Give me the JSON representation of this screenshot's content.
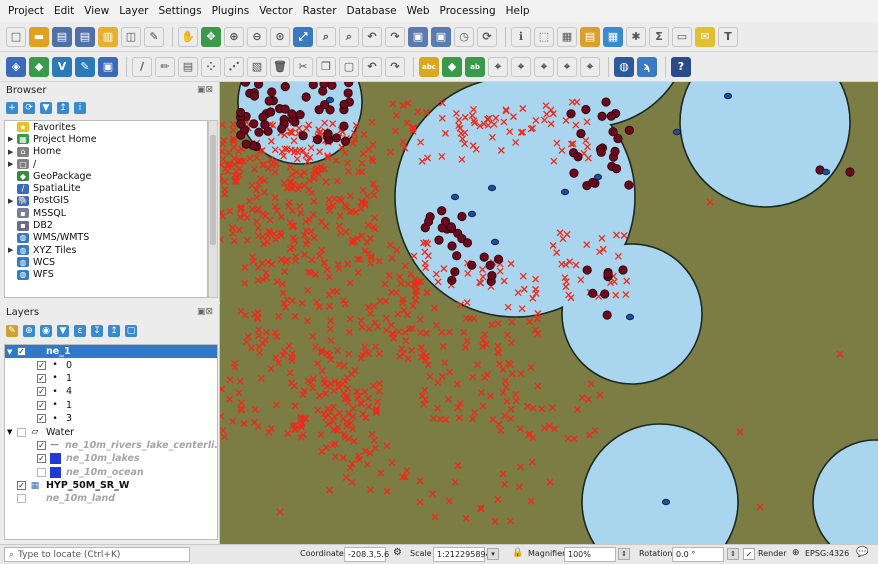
{
  "menubar": {
    "items": [
      "Project",
      "Edit",
      "View",
      "Layer",
      "Settings",
      "Plugins",
      "Vector",
      "Raster",
      "Database",
      "Web",
      "Processing",
      "Help"
    ]
  },
  "browser": {
    "title": "Browser",
    "items": [
      {
        "label": "Favorites",
        "icon": "star-icon",
        "arrow": ""
      },
      {
        "label": "Project Home",
        "icon": "project-home-icon",
        "arrow": "▶"
      },
      {
        "label": "Home",
        "icon": "home-folder-icon",
        "arrow": "▶"
      },
      {
        "label": "/",
        "icon": "root-folder-icon",
        "arrow": "▶"
      },
      {
        "label": "GeoPackage",
        "icon": "geopackage-icon",
        "arrow": ""
      },
      {
        "label": "SpatiaLite",
        "icon": "spatialite-icon",
        "arrow": ""
      },
      {
        "label": "PostGIS",
        "icon": "postgis-icon",
        "arrow": "▶"
      },
      {
        "label": "MSSQL",
        "icon": "mssql-icon",
        "arrow": ""
      },
      {
        "label": "DB2",
        "icon": "db2-icon",
        "arrow": ""
      },
      {
        "label": "WMS/WMTS",
        "icon": "wms-icon",
        "arrow": ""
      },
      {
        "label": "XYZ Tiles",
        "icon": "xyz-tiles-icon",
        "arrow": "▶"
      },
      {
        "label": "WCS",
        "icon": "wcs-icon",
        "arrow": ""
      },
      {
        "label": "WFS",
        "icon": "wfs-icon",
        "arrow": ""
      }
    ]
  },
  "layers": {
    "title": "Layers",
    "rows": [
      {
        "label": "ne_1",
        "indent": 0,
        "checked": true,
        "selected": true,
        "expand": "▼",
        "sym": "",
        "style": "bold"
      },
      {
        "label": "0",
        "indent": 1,
        "checked": true,
        "sym": "•",
        "style": ""
      },
      {
        "label": "1",
        "indent": 1,
        "checked": true,
        "sym": "•",
        "style": ""
      },
      {
        "label": "4",
        "indent": 1,
        "checked": true,
        "sym": "•",
        "style": ""
      },
      {
        "label": "1",
        "indent": 1,
        "checked": true,
        "sym": "•",
        "style": ""
      },
      {
        "label": "3",
        "indent": 1,
        "checked": true,
        "sym": "•",
        "style": ""
      },
      {
        "label": "Water",
        "indent": 0,
        "checked": false,
        "expand": "▼",
        "sym": "",
        "style": ""
      },
      {
        "label": "ne_10m_rivers_lake_centerli...",
        "indent": 1,
        "checked": true,
        "sym": "—",
        "style": "italic-grey"
      },
      {
        "label": "ne_10m_lakes",
        "indent": 1,
        "checked": true,
        "swatch": "#1f3ad6",
        "style": "italic-grey"
      },
      {
        "label": "ne_10m_ocean",
        "indent": 1,
        "checked": false,
        "swatch": "#1f3ad6",
        "style": "italic-grey"
      },
      {
        "label": "HYP_50M_SR_W",
        "indent": 0,
        "checked": true,
        "sym": "▦",
        "style": "bold"
      },
      {
        "label": "ne_10m_land",
        "indent": 0,
        "checked": false,
        "sym": "",
        "style": "italic-grey"
      }
    ]
  },
  "statusbar": {
    "locator_placeholder": "Type to locate (Ctrl+K)",
    "coordinate_label": "Coordinate",
    "coordinate_value": "-208.3,5.6",
    "scale_label": "Scale",
    "scale_value": "1:212295894",
    "magnifier_label": "Magnifier",
    "magnifier_value": "100%",
    "rotation_label": "Rotation",
    "rotation_value": "0.0 °",
    "render_label": "Render",
    "crs_label": "EPSG:4326"
  },
  "map": {
    "colors": {
      "land": "#7b7d45",
      "water": "#a9d6ee",
      "outline": "#1a2a20",
      "cross": "#ee2a1a",
      "dark_point": "#6a0a1c",
      "blue_point": "#1e4fa0"
    }
  }
}
